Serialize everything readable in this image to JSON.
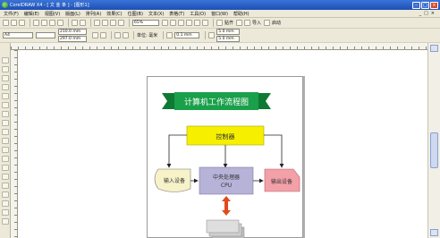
{
  "window": {
    "title": "CorelDRAW X4 - [ 文 金 条 ] - [图形1]"
  },
  "menu": {
    "items": [
      "文件(F)",
      "编辑(E)",
      "视图(V)",
      "版面(L)",
      "排列(A)",
      "效果(C)",
      "位图(B)",
      "文本(X)",
      "表格(T)",
      "工具(O)",
      "窗口(W)",
      "帮助(H)"
    ]
  },
  "toolbar1": {
    "zoom": "65%",
    "snap_label": "贴齐",
    "import_label": "导入",
    "launch_label": "启动"
  },
  "toolbar2": {
    "paper": "A4",
    "width": "210.0 mm",
    "height": "297.0 mm",
    "units_label": "单位: 毫米",
    "nudge": "0.1 mm",
    "dup_x": "5.0 mm",
    "dup_y": "5.0 mm"
  },
  "diagram": {
    "title": "计算机工作流程图",
    "controller": "控制器",
    "input": "输入设备",
    "cpu_line1": "中央处理器",
    "cpu_line2": "CPU",
    "output": "输出设备",
    "colors": {
      "banner": "#1aa04a",
      "controller": "#f6f000",
      "input": "#f7f2c8",
      "cpu": "#b6b2d8",
      "output": "#f3a0a8",
      "arrow": "#e04a1e",
      "memory": "#d8d8d8"
    }
  }
}
